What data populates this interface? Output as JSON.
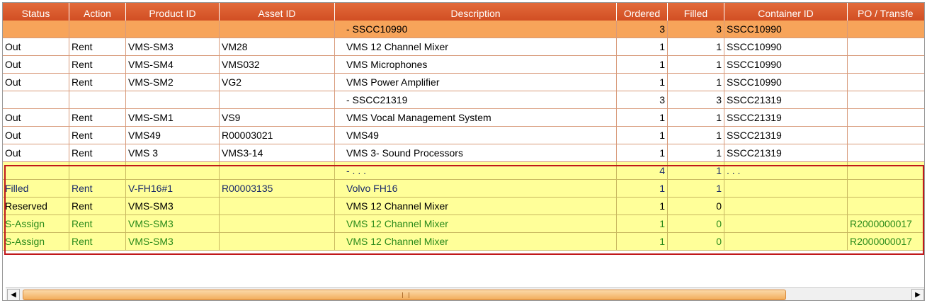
{
  "columns": [
    "Status",
    "Action",
    "Product ID",
    "Asset ID",
    "Description",
    "Ordered",
    "Filled",
    "Container ID",
    "PO / Transfe"
  ],
  "rows": [
    {
      "kind": "group",
      "status": "",
      "action": "",
      "product": "",
      "asset": "",
      "desc": "- SSCC10990",
      "ordered": "3",
      "filled": "3",
      "container": "SSCC10990",
      "po": ""
    },
    {
      "kind": "normal",
      "status": "Out",
      "action": "Rent",
      "product": "VMS-SM3",
      "asset": "VM28",
      "desc": "VMS 12  Channel Mixer",
      "ordered": "1",
      "filled": "1",
      "container": "SSCC10990",
      "po": ""
    },
    {
      "kind": "normal",
      "status": "Out",
      "action": "Rent",
      "product": "VMS-SM4",
      "asset": "VMS032",
      "desc": "VMS Microphones",
      "ordered": "1",
      "filled": "1",
      "container": "SSCC10990",
      "po": ""
    },
    {
      "kind": "normal",
      "status": "Out",
      "action": "Rent",
      "product": "VMS-SM2",
      "asset": "VG2",
      "desc": "VMS Power Amplifier",
      "ordered": "1",
      "filled": "1",
      "container": "SSCC10990",
      "po": ""
    },
    {
      "kind": "normal",
      "status": "",
      "action": "",
      "product": "",
      "asset": "",
      "desc": "- SSCC21319",
      "ordered": "3",
      "filled": "3",
      "container": "SSCC21319",
      "po": ""
    },
    {
      "kind": "normal",
      "status": "Out",
      "action": "Rent",
      "product": "VMS-SM1",
      "asset": "VS9",
      "desc": "VMS Vocal Management System",
      "ordered": "1",
      "filled": "1",
      "container": "SSCC21319",
      "po": ""
    },
    {
      "kind": "normal",
      "status": "Out",
      "action": "Rent",
      "product": "VMS49",
      "asset": "R00003021",
      "desc": "VMS49",
      "ordered": "1",
      "filled": "1",
      "container": "SSCC21319",
      "po": ""
    },
    {
      "kind": "normal",
      "status": "Out",
      "action": "Rent",
      "product": "VMS 3",
      "asset": "VMS3-14",
      "desc": "VMS 3- Sound Processors",
      "ordered": "1",
      "filled": "1",
      "container": "SSCC21319",
      "po": ""
    },
    {
      "kind": "hl navy",
      "status": "",
      "action": "",
      "product": "",
      "asset": "",
      "desc": "- . . .",
      "ordered": "4",
      "filled": "1",
      "container": ". . .",
      "po": ""
    },
    {
      "kind": "hl navy",
      "status": "Filled",
      "action": "Rent",
      "product": "V-FH16#1",
      "asset": "R00003135",
      "desc": "Volvo FH16",
      "ordered": "1",
      "filled": "1",
      "container": "",
      "po": ""
    },
    {
      "kind": "hl",
      "status": "Reserved",
      "action": "Rent",
      "product": "VMS-SM3",
      "asset": "",
      "desc": "VMS 12  Channel Mixer",
      "ordered": "1",
      "filled": "0",
      "container": "",
      "po": ""
    },
    {
      "kind": "hl green",
      "status": "S-Assign",
      "action": "Rent",
      "product": "VMS-SM3",
      "asset": "",
      "desc": "VMS 12  Channel Mixer",
      "ordered": "1",
      "filled": "0",
      "container": "",
      "po": "R2000000017"
    },
    {
      "kind": "hl green",
      "status": "S-Assign",
      "action": "Rent",
      "product": "VMS-SM3",
      "asset": "",
      "desc": "VMS 12  Channel Mixer",
      "ordered": "1",
      "filled": "0",
      "container": "",
      "po": "R2000000017"
    }
  ],
  "scrollbar": {
    "left_arrow": "◀",
    "right_arrow": "▶"
  }
}
